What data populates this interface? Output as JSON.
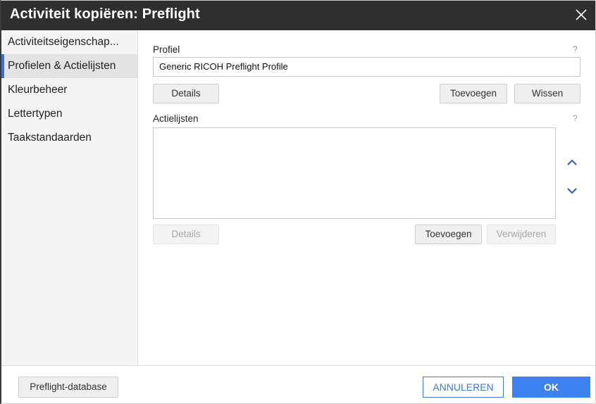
{
  "dialog": {
    "title": "Activiteit kopiëren: Preflight",
    "close_icon": "close-icon"
  },
  "sidebar": {
    "items": [
      {
        "label": "Activiteitseigenschap..."
      },
      {
        "label": "Profielen & Actielijsten"
      },
      {
        "label": "Kleurbeheer"
      },
      {
        "label": "Lettertypen"
      },
      {
        "label": "Taakstandaarden"
      }
    ],
    "active_index": 1
  },
  "profiel": {
    "label": "Profiel",
    "help": "?",
    "value": "Generic RICOH Preflight Profile",
    "details_label": "Details",
    "add_label": "Toevoegen",
    "clear_label": "Wissen"
  },
  "actielijsten": {
    "label": "Actielijsten",
    "help": "?",
    "items": [],
    "move_up_icon": "chevron-up-icon",
    "move_down_icon": "chevron-down-icon",
    "details_label": "Details",
    "add_label": "Toevoegen",
    "remove_label": "Verwijderen"
  },
  "footer": {
    "database_label": "Preflight-database",
    "cancel_label": "ANNULEREN",
    "ok_label": "OK"
  },
  "colors": {
    "titlebar": "#2f2f2f",
    "accent": "#3e82f0",
    "active_marker": "#3d6fd0"
  }
}
